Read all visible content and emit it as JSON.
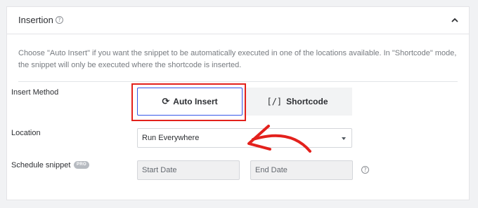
{
  "header": {
    "title": "Insertion",
    "help_icon": "question-circle-icon",
    "collapse_icon": "chevron-up-icon"
  },
  "description": "Choose \"Auto Insert\" if you want the snippet to be automatically executed in one of the locations available. In \"Shortcode\" mode, the snippet will only be executed where the shortcode is inserted.",
  "insert_method": {
    "label": "Insert Method",
    "options": [
      {
        "label": "Auto Insert",
        "icon": "sync-icon",
        "selected": true
      },
      {
        "label": "Shortcode",
        "icon": "shortcode-icon",
        "icon_text": "[/]",
        "selected": false
      }
    ]
  },
  "location": {
    "label": "Location",
    "value": "Run Everywhere"
  },
  "schedule": {
    "label": "Schedule snippet",
    "badge": "PRO",
    "start_placeholder": "Start Date",
    "end_placeholder": "End Date",
    "help_icon": "question-circle-icon"
  },
  "annotation_color": "#e3211c",
  "accent_color": "#3858e9"
}
